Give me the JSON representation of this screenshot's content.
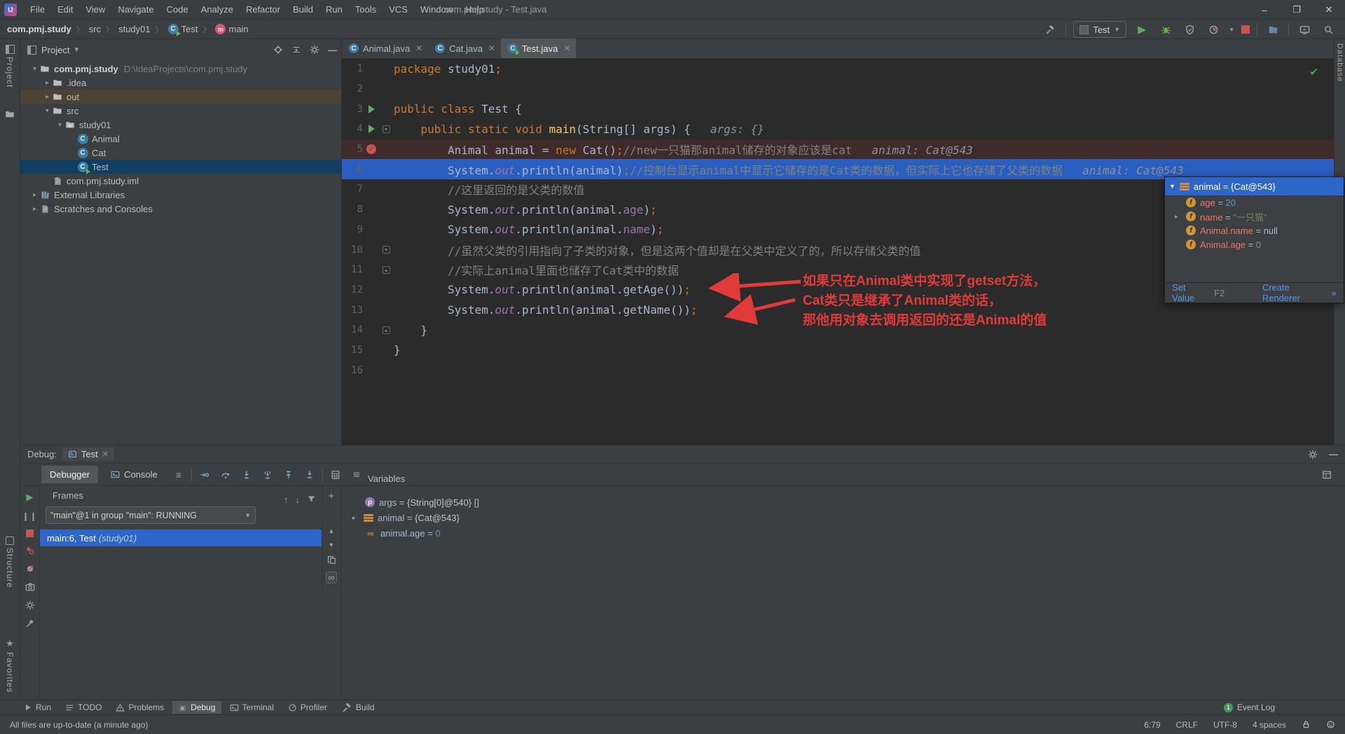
{
  "titlebar": {
    "logo": "IJ",
    "menus": [
      "File",
      "Edit",
      "View",
      "Navigate",
      "Code",
      "Analyze",
      "Refactor",
      "Build",
      "Run",
      "Tools",
      "VCS",
      "Window",
      "Help"
    ],
    "title": "com.pmj.study - Test.java",
    "minimize": "–",
    "maximize": "❐",
    "close": "✕"
  },
  "navbar": {
    "breadcrumbs": [
      {
        "label": "com.pmj.study",
        "bold": true
      },
      {
        "label": "src"
      },
      {
        "label": "study01"
      },
      {
        "label": "Test",
        "icon": "class-run"
      },
      {
        "label": "main",
        "icon": "method"
      }
    ],
    "run_config": "Test"
  },
  "stripes": {
    "project": "Project",
    "structure": "Structure",
    "favorites": "Favorites",
    "database": "Database"
  },
  "project": {
    "title": "Project",
    "tree": [
      {
        "lvl": 0,
        "chev": "v",
        "icon": "project",
        "label": "com.pmj.study",
        "extra": "D:\\IdeaProjects\\com.pmj.study",
        "bold": true
      },
      {
        "lvl": 1,
        "chev": ">",
        "icon": "folder",
        "label": ".idea"
      },
      {
        "lvl": 1,
        "chev": ">",
        "icon": "folder-out",
        "label": "out",
        "rowbg": "outbg"
      },
      {
        "lvl": 1,
        "chev": "v",
        "icon": "folder-src",
        "label": "src"
      },
      {
        "lvl": 2,
        "chev": "v",
        "icon": "package",
        "label": "study01"
      },
      {
        "lvl": 3,
        "chev": "",
        "icon": "class",
        "label": "Animal"
      },
      {
        "lvl": 3,
        "chev": "",
        "icon": "class",
        "label": "Cat"
      },
      {
        "lvl": 3,
        "chev": "",
        "icon": "class-run",
        "label": "Test",
        "sel": true
      },
      {
        "lvl": 1,
        "chev": "",
        "icon": "iml",
        "label": "com.pmj.study.iml"
      },
      {
        "lvl": 0,
        "chev": ">",
        "icon": "libs",
        "label": "External Libraries"
      },
      {
        "lvl": 0,
        "chev": ">",
        "icon": "scratch",
        "label": "Scratches and Consoles"
      }
    ]
  },
  "editor": {
    "tabs": [
      {
        "label": "Animal.java",
        "icon": "class",
        "active": false
      },
      {
        "label": "Cat.java",
        "icon": "class",
        "active": false
      },
      {
        "label": "Test.java",
        "icon": "class-run",
        "active": true
      }
    ],
    "close_glyph": "✕",
    "lines": [
      {
        "num": 1,
        "segs": [
          {
            "t": "package ",
            "c": "kw"
          },
          {
            "t": "study01",
            "c": "def"
          },
          {
            "t": ";",
            "c": "sc"
          }
        ]
      },
      {
        "num": 2,
        "segs": []
      },
      {
        "num": 3,
        "gutter": "run",
        "segs": [
          {
            "t": "public class ",
            "c": "kw"
          },
          {
            "t": "Test {",
            "c": "def"
          }
        ]
      },
      {
        "num": 4,
        "gutter": "run",
        "fold": "down",
        "segs": [
          {
            "t": "    ",
            "c": "def"
          },
          {
            "t": "public static void ",
            "c": "kw"
          },
          {
            "t": "main",
            "c": "mth"
          },
          {
            "t": "(String[] args) {",
            "c": "def"
          }
        ],
        "hint": "args: {}"
      },
      {
        "num": 5,
        "gutter": "bp",
        "bg": "bp",
        "segs": [
          {
            "t": "        Animal animal = ",
            "c": "def"
          },
          {
            "t": "new ",
            "c": "kw"
          },
          {
            "t": "Cat()",
            "c": "def"
          },
          {
            "t": ";",
            "c": "sc"
          },
          {
            "t": "//new一只猫那animal储存的对象应该是cat",
            "c": "cmt"
          }
        ],
        "hint": "animal: Cat@543"
      },
      {
        "num": 6,
        "bg": "exec",
        "segs": [
          {
            "t": "        System.",
            "c": "def"
          },
          {
            "t": "out",
            "c": "fldi"
          },
          {
            "t": ".println(animal)",
            "c": "def"
          },
          {
            "t": ";",
            "c": "sc"
          },
          {
            "t": "//控制台显示animal中显示它储存的是Cat类的数据，但实际上它也存储了父类的数据",
            "c": "cmt"
          }
        ],
        "hint": "animal: Cat@543"
      },
      {
        "num": 7,
        "segs": [
          {
            "t": "        ",
            "c": "def"
          },
          {
            "t": "//这里返回的是父类的数值",
            "c": "cmt"
          }
        ]
      },
      {
        "num": 8,
        "segs": [
          {
            "t": "        System.",
            "c": "def"
          },
          {
            "t": "out",
            "c": "fldi"
          },
          {
            "t": ".println(animal.",
            "c": "def"
          },
          {
            "t": "age",
            "c": "fld"
          },
          {
            "t": ")",
            "c": "def"
          },
          {
            "t": ";",
            "c": "sc"
          }
        ]
      },
      {
        "num": 9,
        "segs": [
          {
            "t": "        System.",
            "c": "def"
          },
          {
            "t": "out",
            "c": "fldi"
          },
          {
            "t": ".println(animal.",
            "c": "def"
          },
          {
            "t": "name",
            "c": "fld"
          },
          {
            "t": ")",
            "c": "def"
          },
          {
            "t": ";",
            "c": "sc"
          }
        ]
      },
      {
        "num": 10,
        "fold": "down",
        "segs": [
          {
            "t": "        ",
            "c": "def"
          },
          {
            "t": "//虽然父类的引用指向了子类的对象，但是这两个值却是在父类中定义了的，所以存储父类的值",
            "c": "cmt"
          }
        ]
      },
      {
        "num": 11,
        "fold": "up",
        "segs": [
          {
            "t": "        ",
            "c": "def"
          },
          {
            "t": "//实际上animal里面也储存了Cat类中的数据",
            "c": "cmt"
          }
        ]
      },
      {
        "num": 12,
        "segs": [
          {
            "t": "        System.",
            "c": "def"
          },
          {
            "t": "out",
            "c": "fldi"
          },
          {
            "t": ".println(animal.getAge())",
            "c": "def"
          },
          {
            "t": ";",
            "c": "sc"
          }
        ]
      },
      {
        "num": 13,
        "segs": [
          {
            "t": "        System.",
            "c": "def"
          },
          {
            "t": "out",
            "c": "fldi"
          },
          {
            "t": ".println(animal.getName())",
            "c": "def"
          },
          {
            "t": ";",
            "c": "sc"
          }
        ]
      },
      {
        "num": 14,
        "fold": "up",
        "segs": [
          {
            "t": "    }",
            "c": "def"
          }
        ]
      },
      {
        "num": 15,
        "segs": [
          {
            "t": "}",
            "c": "def"
          }
        ]
      },
      {
        "num": 16,
        "segs": []
      }
    ]
  },
  "annotation": {
    "line1": "如果只在Animal类中实现了getset方法，",
    "line2": "Cat类只是继承了Animal类的话，",
    "line3": "那他用对象去调用返回的还是Animal的值"
  },
  "popup": {
    "header": {
      "name": "animal",
      "eq": " = ",
      "value": "{Cat@543}"
    },
    "rows": [
      {
        "icon": "f",
        "name": "age",
        "eq": " = ",
        "value": "20",
        "vclass": "vnum"
      },
      {
        "icon": "f",
        "chev": true,
        "name": "name",
        "eq": " = ",
        "value": "\"一只猫\"",
        "vclass": "vstr"
      },
      {
        "icon": "f",
        "name": "Animal.name",
        "eq": " = ",
        "value": "null",
        "vclass": "vplain"
      },
      {
        "icon": "f",
        "name": "Animal.age",
        "eq": " = ",
        "value": "0",
        "vclass": "vnum"
      }
    ],
    "set_value": "Set Value",
    "f2": "F2",
    "create_renderer": "Create Renderer",
    "more": "»"
  },
  "debug": {
    "label": "Debug:",
    "session_tab": "Test",
    "tab_debugger": "Debugger",
    "tab_console": "Console",
    "frames_title": "Frames",
    "thread": "\"main\"@1 in group \"main\": RUNNING",
    "frame_main": "main:6, Test",
    "frame_loc": "(study01)",
    "variables_title": "Variables",
    "var_rows": [
      {
        "icon": "param",
        "name": "args",
        "eq": " = ",
        "value": "{String[0]@540}",
        "suffix": " []",
        "vclass": "vref"
      },
      {
        "icon": "object",
        "chev": true,
        "name": "animal",
        "eq": " = ",
        "value": "{Cat@543}",
        "vclass": "vref"
      },
      {
        "icon": "watch",
        "name": "animal.age",
        "eq": " = ",
        "value": "0",
        "vclass": "vnum"
      }
    ]
  },
  "toolwindow_bar": {
    "buttons": [
      {
        "label": "Run",
        "icon": "play"
      },
      {
        "label": "TODO",
        "icon": "todo"
      },
      {
        "label": "Problems",
        "icon": "warn"
      },
      {
        "label": "Debug",
        "icon": "debug",
        "active": true
      },
      {
        "label": "Terminal",
        "icon": "terminal"
      },
      {
        "label": "Profiler",
        "icon": "profiler"
      },
      {
        "label": "Build",
        "icon": "hammer"
      }
    ],
    "event_log": "Event Log",
    "event_badge": "1"
  },
  "statusbar": {
    "message": "All files are up-to-date (a minute ago)",
    "caret": "6:79",
    "line_sep": "CRLF",
    "encoding": "UTF-8",
    "indent": "4 spaces"
  }
}
